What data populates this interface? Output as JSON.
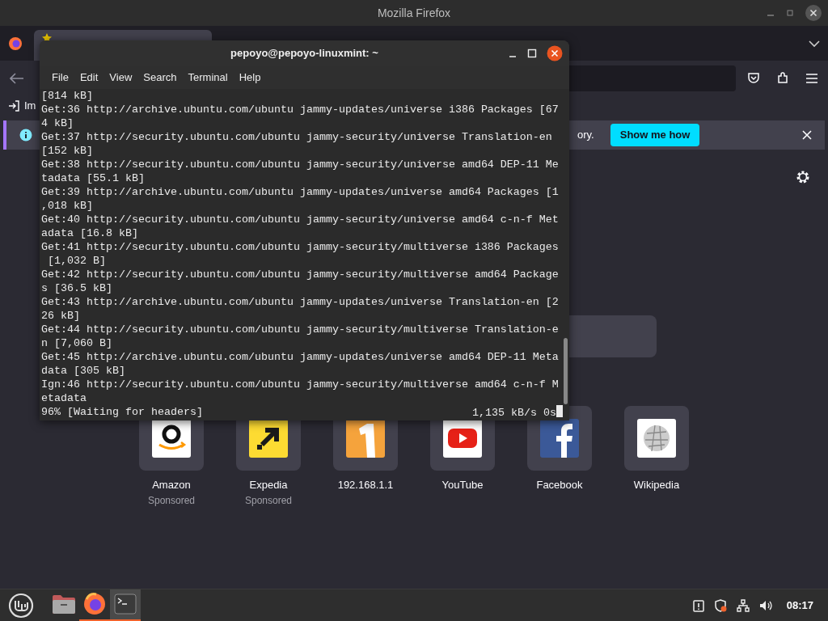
{
  "firefox": {
    "title": "Mozilla Firefox",
    "bookmark_fragment": "Im",
    "notification": {
      "text_fragment": "ory.",
      "button": "Show me how"
    },
    "top_sites": [
      {
        "kind": "amazon",
        "title": "Amazon",
        "sponsored": "Sponsored"
      },
      {
        "kind": "expedia",
        "title": "Expedia",
        "sponsored": "Sponsored"
      },
      {
        "kind": "router",
        "title": "192.168.1.1"
      },
      {
        "kind": "youtube",
        "title": "YouTube"
      },
      {
        "kind": "facebook",
        "title": "Facebook"
      },
      {
        "kind": "wikipedia",
        "title": "Wikipedia"
      }
    ]
  },
  "terminal": {
    "title": "pepoyo@pepoyo-linuxmint: ~",
    "menu": [
      "File",
      "Edit",
      "View",
      "Search",
      "Terminal",
      "Help"
    ],
    "lines": [
      "[814 kB]",
      "Get:36 http://archive.ubuntu.com/ubuntu jammy-updates/universe i386 Packages [67",
      "4 kB]",
      "Get:37 http://security.ubuntu.com/ubuntu jammy-security/universe Translation-en",
      "[152 kB]",
      "Get:38 http://security.ubuntu.com/ubuntu jammy-security/universe amd64 DEP-11 Me",
      "tadata [55.1 kB]",
      "Get:39 http://archive.ubuntu.com/ubuntu jammy-updates/universe amd64 Packages [1",
      ",018 kB]",
      "Get:40 http://security.ubuntu.com/ubuntu jammy-security/universe amd64 c-n-f Met",
      "adata [16.8 kB]",
      "Get:41 http://security.ubuntu.com/ubuntu jammy-security/multiverse i386 Packages",
      " [1,032 B]",
      "Get:42 http://security.ubuntu.com/ubuntu jammy-security/multiverse amd64 Package",
      "s [36.5 kB]",
      "Get:43 http://archive.ubuntu.com/ubuntu jammy-updates/universe Translation-en [2",
      "26 kB]",
      "Get:44 http://security.ubuntu.com/ubuntu jammy-security/multiverse Translation-e",
      "n [7,060 B]",
      "Get:45 http://archive.ubuntu.com/ubuntu jammy-updates/universe amd64 DEP-11 Meta",
      "data [305 kB]",
      "Ign:46 http://security.ubuntu.com/ubuntu jammy-security/multiverse amd64 c-n-f M",
      "etadata"
    ],
    "status_left": "96% [Waiting for headers]",
    "status_right": "1,135 kB/s 0s"
  },
  "taskbar": {
    "apps": [
      {
        "kind": "files",
        "running": false,
        "selected": false
      },
      {
        "kind": "firefox",
        "running": true,
        "selected": false
      },
      {
        "kind": "terminal",
        "running": true,
        "selected": true
      }
    ],
    "clock": "08:17"
  }
}
